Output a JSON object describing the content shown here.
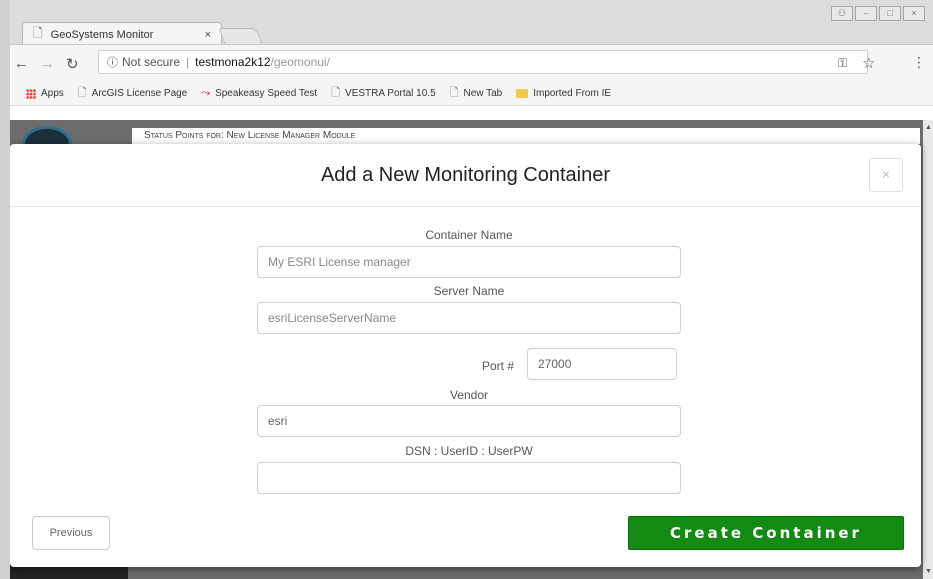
{
  "browser": {
    "tab_title": "GeoSystems Monitor",
    "tab_close": "×",
    "address": {
      "info_icon": "ⓘ",
      "secure_label": "Not secure",
      "host": "testmona2k12",
      "path": "/geomonui/"
    },
    "bookmarks": [
      {
        "label": "Apps",
        "icon": "apps-grid-icon"
      },
      {
        "label": "ArcGIS License Page",
        "icon": "doc-icon"
      },
      {
        "label": "Speakeasy Speed Test",
        "icon": "speed-icon"
      },
      {
        "label": "VESTRA Portal 10.5",
        "icon": "doc-icon"
      },
      {
        "label": "New Tab",
        "icon": "doc-icon"
      },
      {
        "label": "Imported From IE",
        "icon": "folder-icon"
      }
    ]
  },
  "page": {
    "status_header": "Status Points for: New License Manager Module"
  },
  "modal": {
    "title": "Add a New Monitoring Container",
    "close_label": "×",
    "fields": {
      "container_name": {
        "label": "Container Name",
        "placeholder": "My ESRI License manager",
        "value": ""
      },
      "server_name": {
        "label": "Server Name",
        "placeholder": "esriLicenseServerName",
        "value": ""
      },
      "port": {
        "label": "Port #",
        "placeholder": "",
        "value": "27000"
      },
      "vendor": {
        "label": "Vendor",
        "placeholder": "",
        "value": "esri"
      },
      "dsn": {
        "label": "DSN : UserID : UserPW",
        "placeholder": "",
        "value": ""
      }
    },
    "previous_label": "Previous",
    "create_label": "Create Container"
  },
  "colors": {
    "create_button": "#138a13",
    "page_background": "#6c6c6c"
  }
}
